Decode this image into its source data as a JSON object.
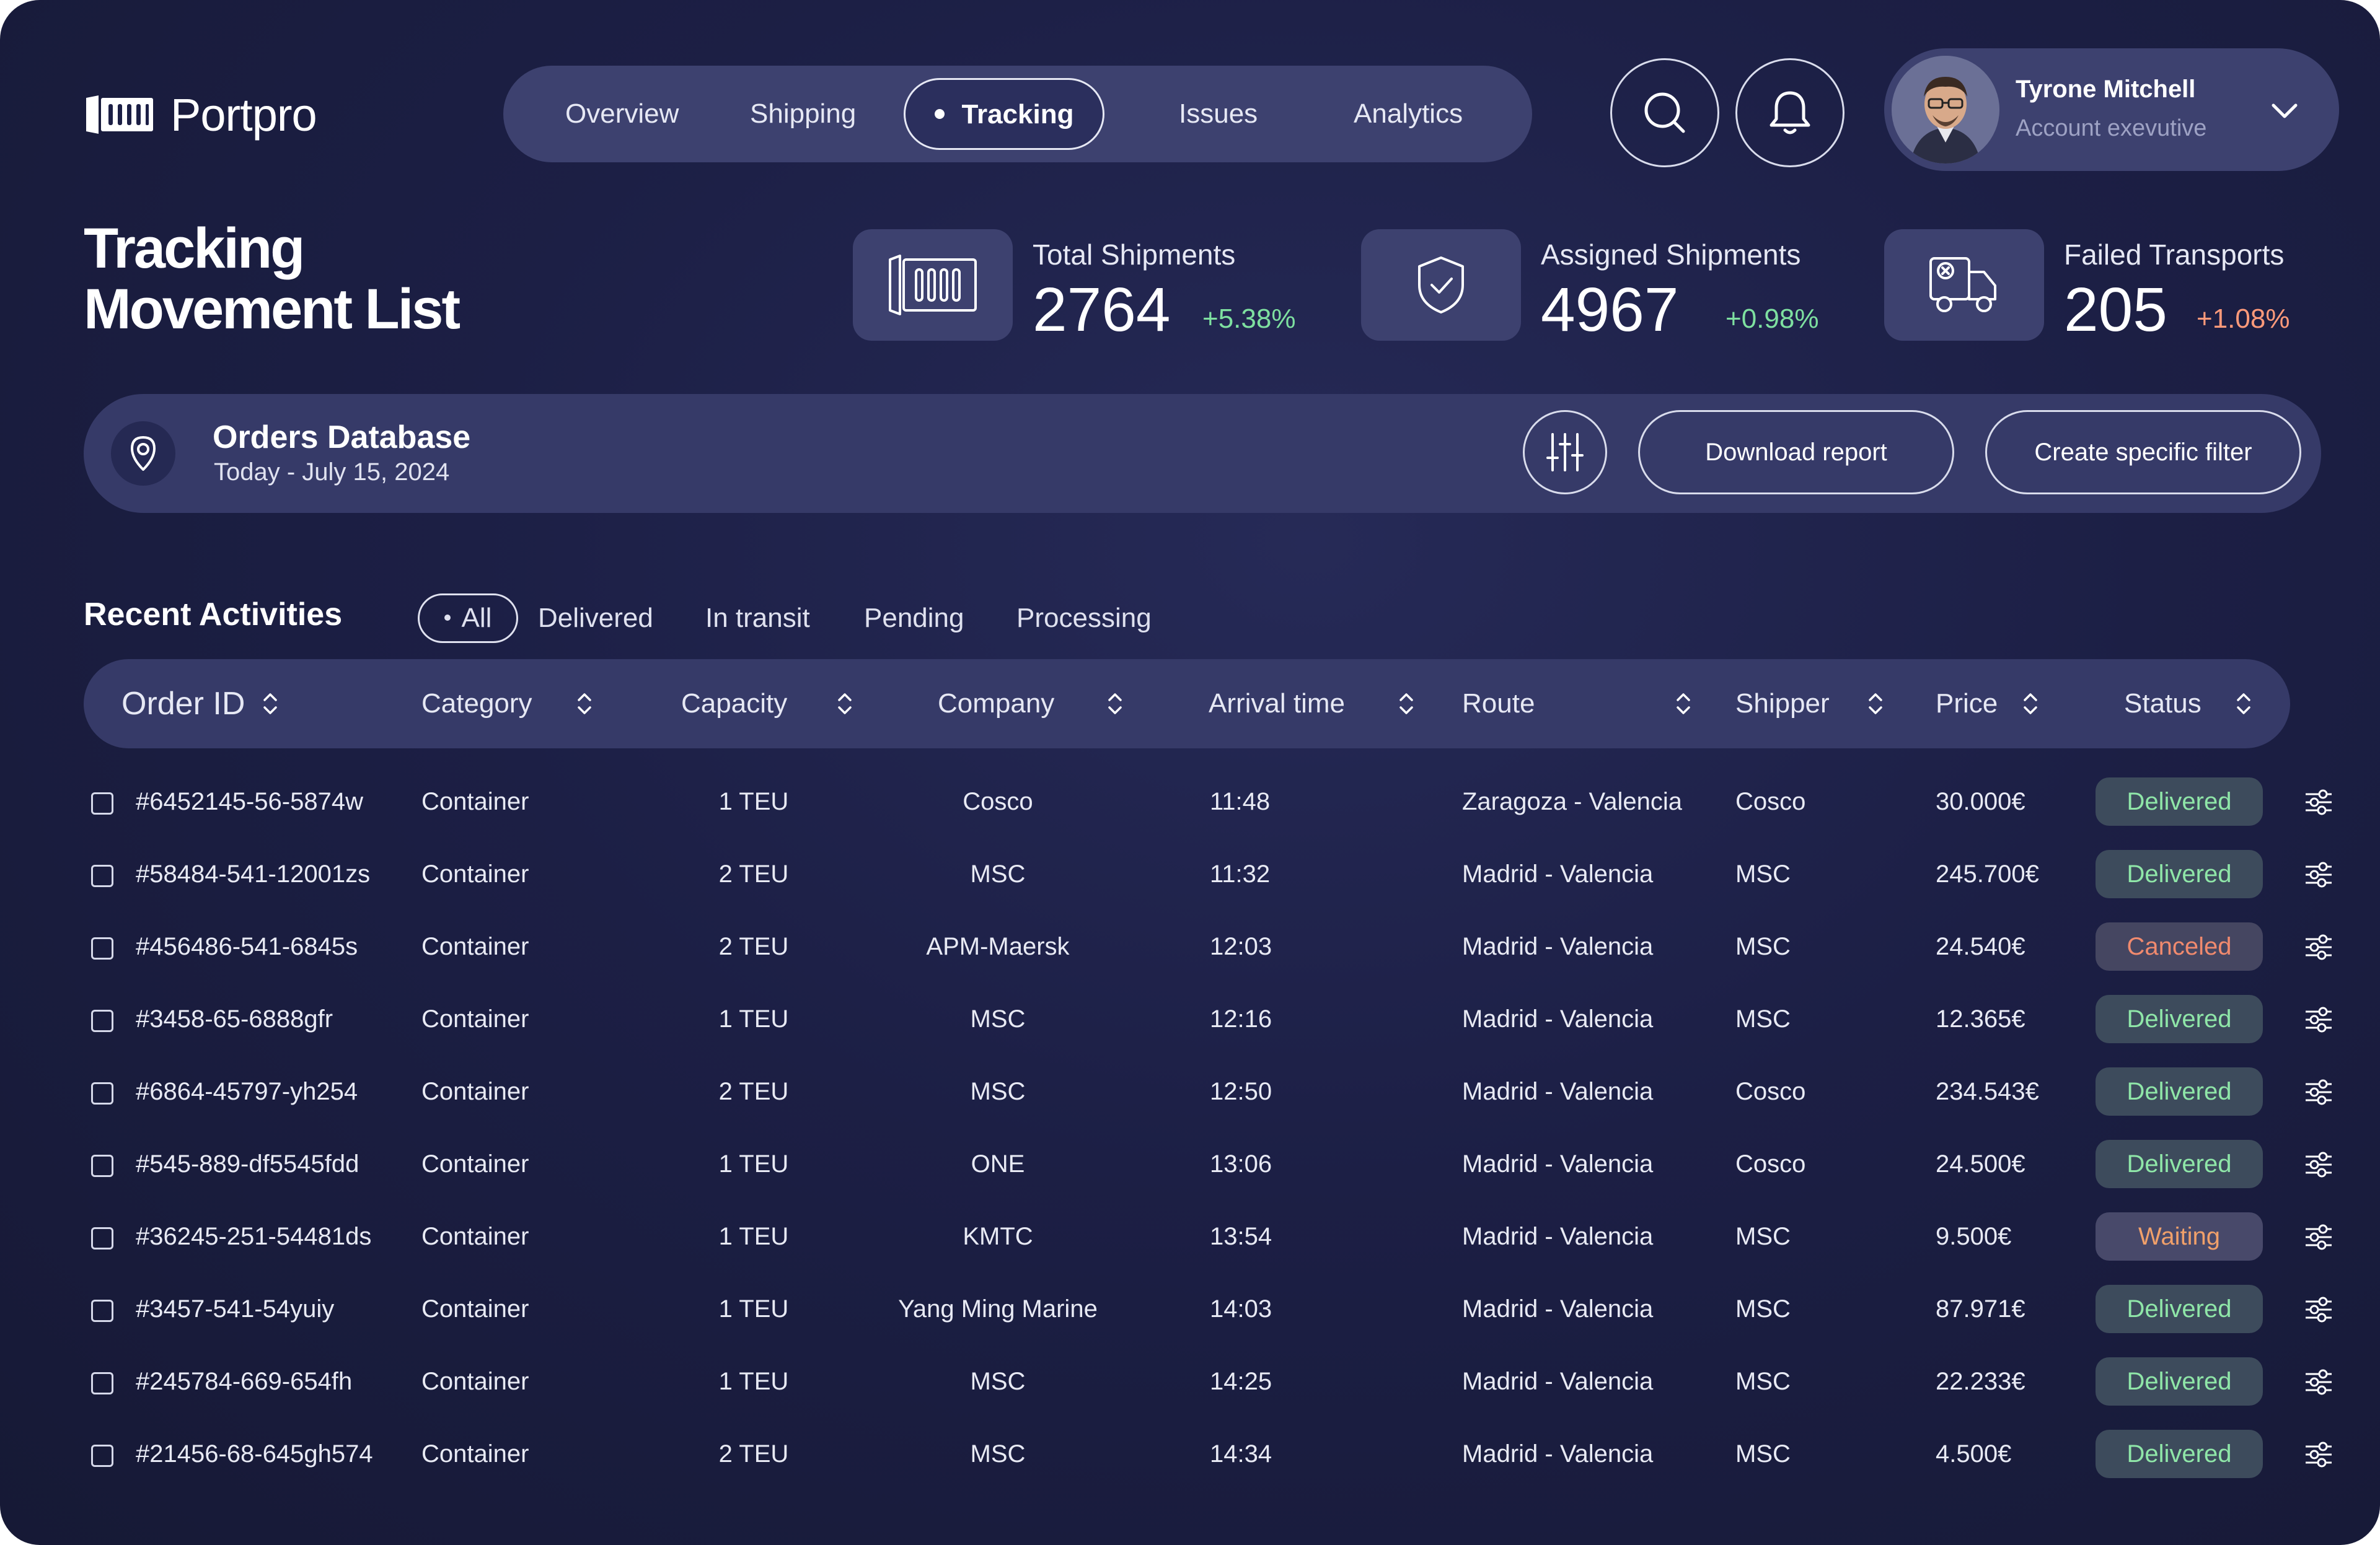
{
  "app": {
    "name": "Portpro"
  },
  "nav": {
    "items": [
      {
        "label": "Overview"
      },
      {
        "label": "Shipping"
      },
      {
        "label": "Tracking",
        "active": true
      },
      {
        "label": "Issues"
      },
      {
        "label": "Analytics"
      }
    ]
  },
  "header_actions": {
    "search_icon": "search-icon",
    "notification_icon": "bell-icon"
  },
  "user": {
    "name": "Tyrone Mitchell",
    "role": "Account exevutive"
  },
  "page": {
    "title_line1": "Tracking",
    "title_line2": "Movement List"
  },
  "stats": [
    {
      "label": "Total Shipments",
      "value": "2764",
      "change": "+5.38%",
      "color": "#7ee0a0",
      "icon": "container-icon"
    },
    {
      "label": "Assigned Shipments",
      "value": "4967",
      "change": "+0.98%",
      "color": "#7ee0a0",
      "icon": "shield-check-icon"
    },
    {
      "label": "Failed Transports",
      "value": "205",
      "change": "+1.08%",
      "color": "#ff9a7a",
      "icon": "truck-failed-icon"
    }
  ],
  "database": {
    "title": "Orders Database",
    "date": "Today - July 15, 2024",
    "download_label": "Download report",
    "filter_label": "Create specific filter"
  },
  "activities": {
    "title": "Recent Activities",
    "tabs": [
      {
        "label": "All",
        "active": true
      },
      {
        "label": "Delivered"
      },
      {
        "label": "In transit"
      },
      {
        "label": "Pending"
      },
      {
        "label": "Processing"
      }
    ]
  },
  "table": {
    "columns": [
      "Order ID",
      "Category",
      "Capacity",
      "Company",
      "Arrival time",
      "Route",
      "Shipper",
      "Price",
      "Status"
    ],
    "rows": [
      {
        "id": "#6452145-56-5874w",
        "category": "Container",
        "capacity": "1 TEU",
        "company": "Cosco",
        "arrival": "11:48",
        "route": "Zaragoza - Valencia",
        "shipper": "Cosco",
        "price": "30.000€",
        "status": "Delivered"
      },
      {
        "id": "#58484-541-12001zs",
        "category": "Container",
        "capacity": "2 TEU",
        "company": "MSC",
        "arrival": "11:32",
        "route": "Madrid - Valencia",
        "shipper": "MSC",
        "price": "245.700€",
        "status": "Delivered"
      },
      {
        "id": "#456486-541-6845s",
        "category": "Container",
        "capacity": "2 TEU",
        "company": "APM-Maersk",
        "arrival": "12:03",
        "route": "Madrid - Valencia",
        "shipper": "MSC",
        "price": "24.540€",
        "status": "Canceled"
      },
      {
        "id": "#3458-65-6888gfr",
        "category": "Container",
        "capacity": "1 TEU",
        "company": "MSC",
        "arrival": "12:16",
        "route": "Madrid - Valencia",
        "shipper": "MSC",
        "price": "12.365€",
        "status": "Delivered"
      },
      {
        "id": "#6864-45797-yh254",
        "category": "Container",
        "capacity": "2 TEU",
        "company": "MSC",
        "arrival": "12:50",
        "route": "Madrid - Valencia",
        "shipper": "Cosco",
        "price": "234.543€",
        "status": "Delivered"
      },
      {
        "id": "#545-889-df5545fdd",
        "category": "Container",
        "capacity": "1 TEU",
        "company": "ONE",
        "arrival": "13:06",
        "route": "Madrid - Valencia",
        "shipper": "Cosco",
        "price": "24.500€",
        "status": "Delivered"
      },
      {
        "id": "#36245-251-54481ds",
        "category": "Container",
        "capacity": "1 TEU",
        "company": "KMTC",
        "arrival": "13:54",
        "route": "Madrid - Valencia",
        "shipper": "MSC",
        "price": "9.500€",
        "status": "Waiting"
      },
      {
        "id": "#3457-541-54yuiy",
        "category": "Container",
        "capacity": "1 TEU",
        "company": "Yang Ming Marine",
        "arrival": "14:03",
        "route": "Madrid - Valencia",
        "shipper": "MSC",
        "price": "87.971€",
        "status": "Delivered"
      },
      {
        "id": "#245784-669-654fh",
        "category": "Container",
        "capacity": "1 TEU",
        "company": "MSC",
        "arrival": "14:25",
        "route": "Madrid - Valencia",
        "shipper": "MSC",
        "price": "22.233€",
        "status": "Delivered"
      },
      {
        "id": "#21456-68-645gh574",
        "category": "Container",
        "capacity": "2 TEU",
        "company": "MSC",
        "arrival": "14:34",
        "route": "Madrid - Valencia",
        "shipper": "MSC",
        "price": "4.500€",
        "status": "Delivered"
      }
    ]
  },
  "status_colors": {
    "Delivered": {
      "text": "#8fe6a8",
      "bg": "#3d4b5c"
    },
    "Canceled": {
      "text": "#f08a6e",
      "bg": "#454661"
    },
    "Waiting": {
      "text": "#f0a06a",
      "bg": "#48496a"
    }
  }
}
